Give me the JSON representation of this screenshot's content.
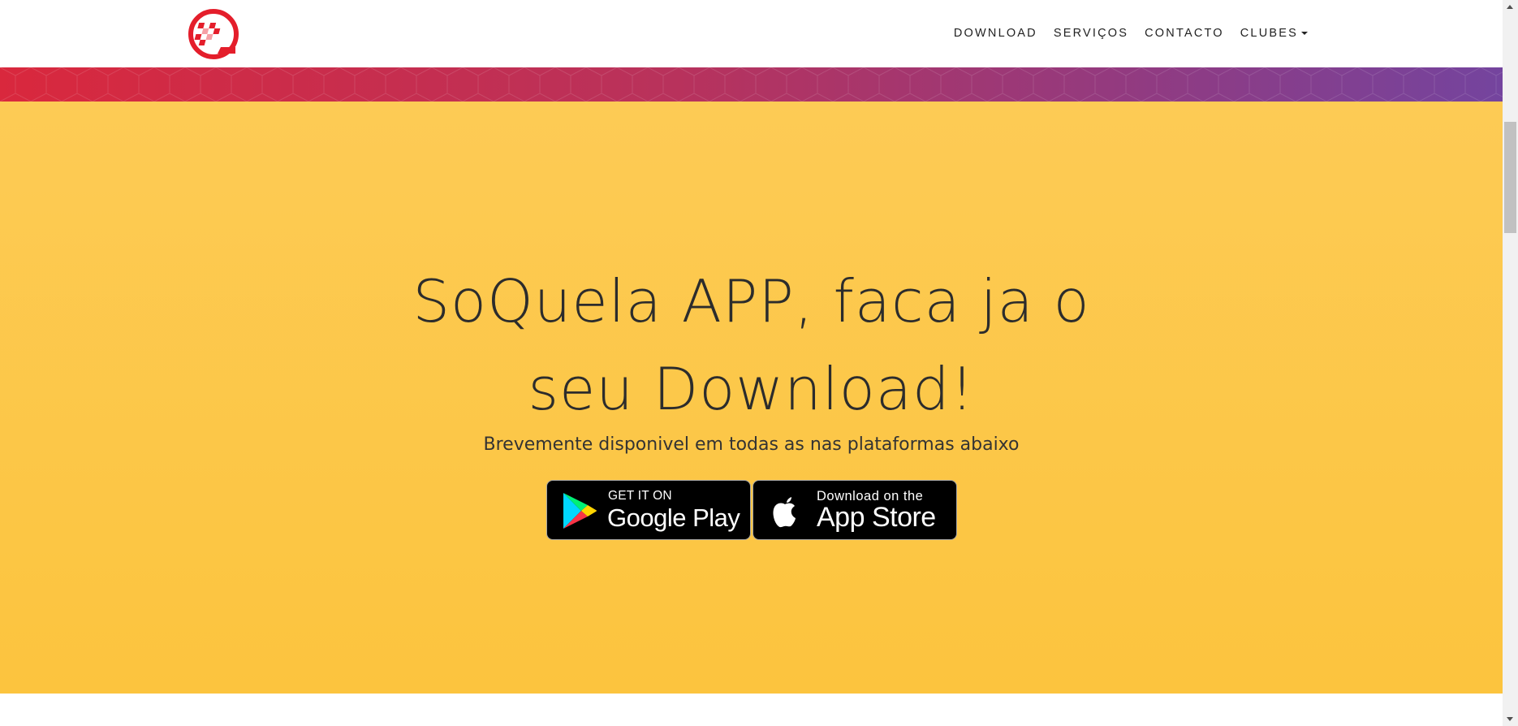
{
  "nav": {
    "logo_name": "soquela-logo",
    "items": [
      {
        "label": "DOWNLOAD"
      },
      {
        "label": "SERVIÇOS"
      },
      {
        "label": "CONTACTO"
      },
      {
        "label": "CLUBES",
        "has_dropdown": true
      }
    ]
  },
  "hero": {
    "title_line1": "SoQuela APP, faca ja o",
    "title_line2": "seu Download!",
    "subtitle": "Brevemente disponivel em todas as nas plataformas abaixo",
    "background_color": "#fcc43e"
  },
  "stores": {
    "google_play": {
      "small": "GET IT ON",
      "big": "Google Play"
    },
    "app_store": {
      "small": "Download on the",
      "big": "App Store"
    }
  },
  "colors": {
    "banner_start": "#d9283d",
    "banner_end": "#74449e",
    "logo_red": "#e41e2b"
  }
}
